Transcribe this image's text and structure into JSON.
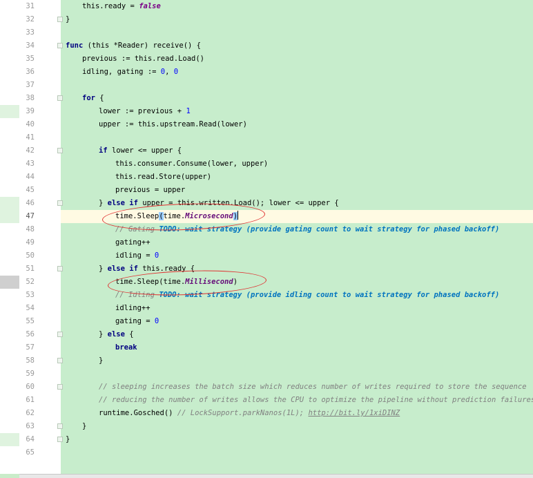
{
  "editor": {
    "current_line": 47,
    "lines": [
      {
        "n": 31,
        "fold": false,
        "indent": 1,
        "tokens": [
          {
            "t": "this.ready = ",
            "k": "p"
          },
          {
            "t": "false",
            "k": "lit"
          }
        ]
      },
      {
        "n": 32,
        "fold": true,
        "indent": 0,
        "tokens": [
          {
            "t": "}",
            "k": "p"
          }
        ]
      },
      {
        "n": 33,
        "fold": false,
        "indent": 0,
        "tokens": []
      },
      {
        "n": 34,
        "fold": true,
        "indent": 0,
        "tokens": [
          {
            "t": "func",
            "k": "kw"
          },
          {
            "t": " (this *Reader) receive() {",
            "k": "p"
          }
        ]
      },
      {
        "n": 35,
        "fold": false,
        "indent": 1,
        "tokens": [
          {
            "t": "previous := this.read.Load()",
            "k": "p"
          }
        ]
      },
      {
        "n": 36,
        "fold": false,
        "indent": 1,
        "tokens": [
          {
            "t": "idling, gating := ",
            "k": "p"
          },
          {
            "t": "0",
            "k": "num"
          },
          {
            "t": ", ",
            "k": "p"
          },
          {
            "t": "0",
            "k": "num"
          }
        ]
      },
      {
        "n": 37,
        "fold": false,
        "indent": 0,
        "tokens": []
      },
      {
        "n": 38,
        "fold": true,
        "indent": 1,
        "tokens": [
          {
            "t": "for",
            "k": "kw"
          },
          {
            "t": " {",
            "k": "p"
          }
        ]
      },
      {
        "n": 39,
        "fold": false,
        "indent": 2,
        "tokens": [
          {
            "t": "lower := previous + ",
            "k": "p"
          },
          {
            "t": "1",
            "k": "num"
          }
        ]
      },
      {
        "n": 40,
        "fold": false,
        "indent": 2,
        "tokens": [
          {
            "t": "upper := this.upstream.Read(lower)",
            "k": "p"
          }
        ]
      },
      {
        "n": 41,
        "fold": false,
        "indent": 0,
        "tokens": []
      },
      {
        "n": 42,
        "fold": true,
        "indent": 2,
        "tokens": [
          {
            "t": "if",
            "k": "kw"
          },
          {
            "t": " lower <= upper {",
            "k": "p"
          }
        ]
      },
      {
        "n": 43,
        "fold": false,
        "indent": 3,
        "tokens": [
          {
            "t": "this.consumer.Consume(lower, upper)",
            "k": "p"
          }
        ]
      },
      {
        "n": 44,
        "fold": false,
        "indent": 3,
        "tokens": [
          {
            "t": "this.read.Store(upper)",
            "k": "p"
          }
        ]
      },
      {
        "n": 45,
        "fold": false,
        "indent": 3,
        "tokens": [
          {
            "t": "previous = upper",
            "k": "p"
          }
        ]
      },
      {
        "n": 46,
        "fold": true,
        "indent": 2,
        "tokens": [
          {
            "t": "} ",
            "k": "p"
          },
          {
            "t": "else if",
            "k": "kw"
          },
          {
            "t": " upper = this.written.Load(); lower <= upper {",
            "k": "p"
          }
        ]
      },
      {
        "n": 47,
        "fold": false,
        "indent": 3,
        "tokens": [
          {
            "t": "time.Sleep",
            "k": "p"
          },
          {
            "t": "(",
            "k": "brace"
          },
          {
            "t": "time.",
            "k": "p"
          },
          {
            "t": "Microsecond",
            "k": "const"
          },
          {
            "t": ")",
            "k": "brace"
          },
          {
            "t": "",
            "k": "caret"
          }
        ]
      },
      {
        "n": 48,
        "fold": false,
        "indent": 3,
        "tokens": [
          {
            "t": "// Gating ",
            "k": "cmt"
          },
          {
            "t": "TODO: wait strategy (provide gating count to wait strategy for phased backoff)",
            "k": "todo"
          }
        ]
      },
      {
        "n": 49,
        "fold": false,
        "indent": 3,
        "tokens": [
          {
            "t": "gating++",
            "k": "p"
          }
        ]
      },
      {
        "n": 50,
        "fold": false,
        "indent": 3,
        "tokens": [
          {
            "t": "idling = ",
            "k": "p"
          },
          {
            "t": "0",
            "k": "num"
          }
        ]
      },
      {
        "n": 51,
        "fold": true,
        "indent": 2,
        "tokens": [
          {
            "t": "} ",
            "k": "p"
          },
          {
            "t": "else if",
            "k": "kw"
          },
          {
            "t": " this.ready {",
            "k": "p"
          }
        ]
      },
      {
        "n": 52,
        "fold": false,
        "indent": 3,
        "tokens": [
          {
            "t": "time.Sleep(time.",
            "k": "p"
          },
          {
            "t": "Millisecond",
            "k": "const"
          },
          {
            "t": ")",
            "k": "p"
          }
        ]
      },
      {
        "n": 53,
        "fold": false,
        "indent": 3,
        "tokens": [
          {
            "t": "// Idling ",
            "k": "cmt"
          },
          {
            "t": "TODO: wait strategy (provide idling count to wait strategy for phased backoff)",
            "k": "todo"
          }
        ]
      },
      {
        "n": 54,
        "fold": false,
        "indent": 3,
        "tokens": [
          {
            "t": "idling++",
            "k": "p"
          }
        ]
      },
      {
        "n": 55,
        "fold": false,
        "indent": 3,
        "tokens": [
          {
            "t": "gating = ",
            "k": "p"
          },
          {
            "t": "0",
            "k": "num"
          }
        ]
      },
      {
        "n": 56,
        "fold": true,
        "indent": 2,
        "tokens": [
          {
            "t": "} ",
            "k": "p"
          },
          {
            "t": "else",
            "k": "kw"
          },
          {
            "t": " {",
            "k": "p"
          }
        ]
      },
      {
        "n": 57,
        "fold": false,
        "indent": 3,
        "tokens": [
          {
            "t": "break",
            "k": "kw"
          }
        ]
      },
      {
        "n": 58,
        "fold": true,
        "indent": 2,
        "tokens": [
          {
            "t": "}",
            "k": "p"
          }
        ]
      },
      {
        "n": 59,
        "fold": false,
        "indent": 0,
        "tokens": []
      },
      {
        "n": 60,
        "fold": true,
        "indent": 2,
        "tokens": [
          {
            "t": "// sleeping increases the batch size which reduces number of writes required to store the sequence",
            "k": "cmt"
          }
        ]
      },
      {
        "n": 61,
        "fold": false,
        "indent": 2,
        "tokens": [
          {
            "t": "// reducing the number of writes allows the CPU to optimize the pipeline without prediction failures",
            "k": "cmt"
          }
        ]
      },
      {
        "n": 62,
        "fold": false,
        "indent": 2,
        "tokens": [
          {
            "t": "runtime.Gosched() ",
            "k": "p"
          },
          {
            "t": "// LockSupport.parkNanos(1L); ",
            "k": "cmt"
          },
          {
            "t": "http://bit.ly/1xiDINZ",
            "k": "url"
          }
        ]
      },
      {
        "n": 63,
        "fold": true,
        "indent": 1,
        "tokens": [
          {
            "t": "}",
            "k": "p"
          }
        ]
      },
      {
        "n": 64,
        "fold": true,
        "indent": 0,
        "tokens": [
          {
            "t": "}",
            "k": "p"
          }
        ]
      },
      {
        "n": 65,
        "fold": false,
        "indent": 0,
        "tokens": []
      }
    ],
    "change_markers": [
      {
        "line": 39,
        "kind": "light"
      },
      {
        "line": 46,
        "kind": "light"
      },
      {
        "line": 47,
        "kind": "light"
      },
      {
        "line": 52,
        "kind": "gray"
      },
      {
        "line": 64,
        "kind": "light"
      }
    ],
    "annotations": [
      {
        "line": 47,
        "name": "annotation-circle-microsecond"
      },
      {
        "line": 52,
        "name": "annotation-circle-millisecond"
      }
    ]
  },
  "colors": {
    "background": "#c7edcc",
    "keyword": "#000080",
    "number": "#0000ff",
    "comment": "#808080",
    "todo": "#0073bf",
    "annotation": "#e03030"
  }
}
